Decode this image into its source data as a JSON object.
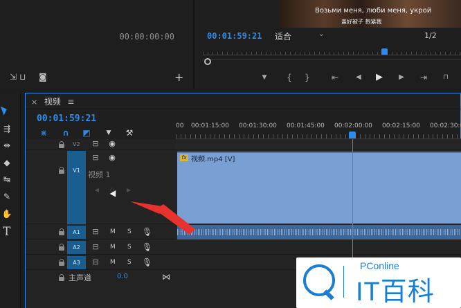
{
  "source_monitor": {
    "timecode": "00:00:00:00"
  },
  "program_monitor": {
    "subtitle_line1": "Возьми меня, люби меня, укрой",
    "subtitle_line2": "盖好被子 抱紧我",
    "timecode": "00:01:59:21",
    "fit_label": "适合",
    "fit_arrow": "⌄",
    "resolution": "1/2",
    "transport_glyphs": [
      "▼",
      "{",
      "}",
      "⇤",
      "◀",
      "▶",
      "▶",
      "⇥"
    ]
  },
  "sequence": {
    "tab_label": "视频",
    "tab_close": "×",
    "tab_menu": "≡",
    "timecode": "00:01:59:21",
    "ruler_labels": [
      "00",
      "00:01:15:00",
      "00:01:30:00",
      "00:01:45:00",
      "00:02:00:00",
      "00:02:15:00",
      "00:02:30:00"
    ]
  },
  "tracks": {
    "v2": {
      "label": "V2"
    },
    "v1": {
      "label": "V1",
      "name": "视频 1"
    },
    "a1": {
      "label": "A1"
    },
    "a2": {
      "label": "A2"
    },
    "a3": {
      "label": "A3"
    },
    "mute": "M",
    "solo": "S",
    "master": {
      "label": "主声道",
      "value": "0.0"
    }
  },
  "clip": {
    "fx": "fx",
    "name": "视频.mp4 [V]"
  },
  "watermark": {
    "brand": "PConline",
    "title": "IT百科"
  },
  "colors": {
    "accent": "#2d8ceb",
    "video_clip": "#7a9fd3",
    "audio_clip": "#3e6799",
    "target_blue": "#1a5d8f",
    "arrow_red": "#e8322d"
  }
}
